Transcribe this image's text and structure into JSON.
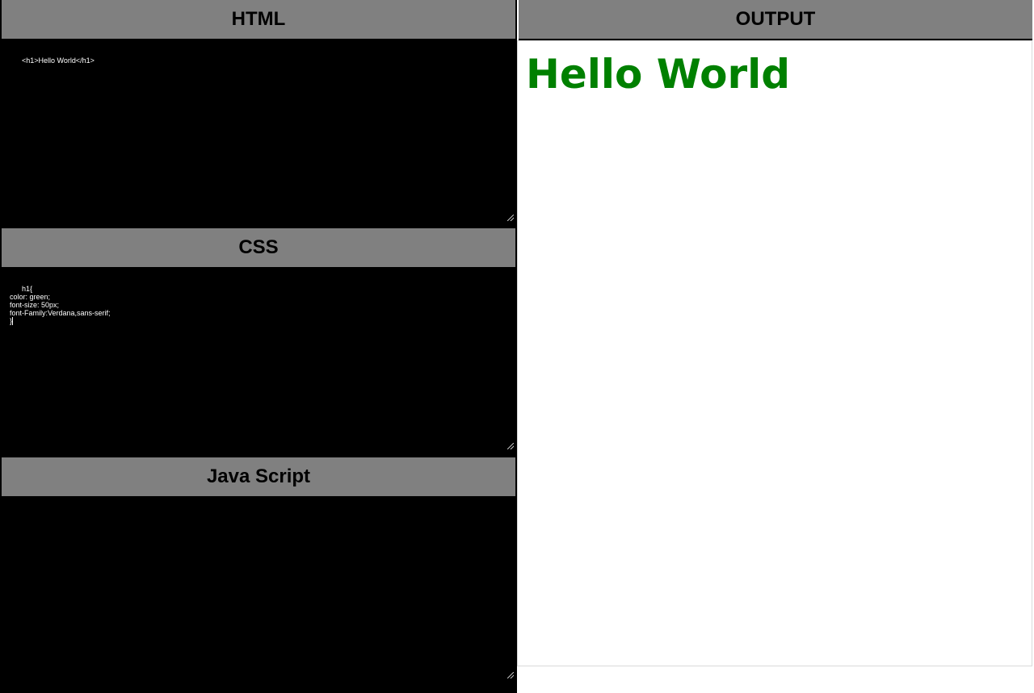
{
  "panes": {
    "html": {
      "title": "HTML",
      "code": "<h1>Hello World</h1>"
    },
    "css": {
      "title": "CSS",
      "code": "h1{\ncolor: green;\nfont-size: 50px;\nfont-Family:Verdana,sans-serif;\n}"
    },
    "js": {
      "title": "Java Script",
      "code": ""
    }
  },
  "output": {
    "title": "OUTPUT",
    "heading": "Hello World",
    "heading_color": "#008000"
  },
  "colors": {
    "header_bg": "#808080",
    "editor_bg": "#000000",
    "editor_text": "#ffffff"
  }
}
